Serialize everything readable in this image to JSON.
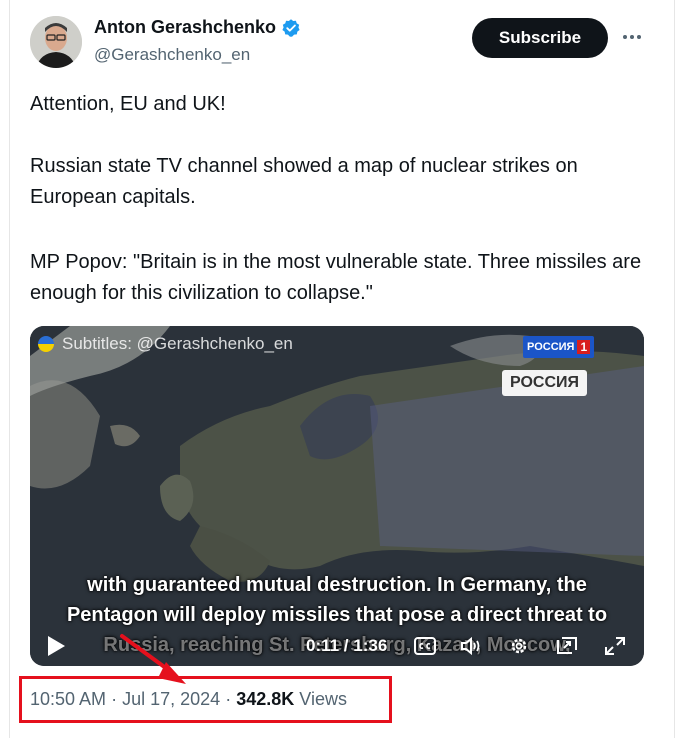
{
  "author": {
    "name": "Anton Gerashchenko",
    "handle": "@Gerashchenko_en",
    "verified": true,
    "verified_color": "#1d9bf0"
  },
  "actions": {
    "subscribe_label": "Subscribe",
    "more_icon": "more-horizontal-icon"
  },
  "tweet": {
    "paragraphs": [
      "Attention, EU and UK!",
      "Russian state TV channel showed a map of nuclear strikes on European capitals.",
      "MP Popov: \"Britain is in the most vulnerable state. Three missiles are enough for this civilization to collapse.\""
    ]
  },
  "video": {
    "subtitle_credit": "Subtitles: @Gerashchenko_en",
    "channel_logo": "РОССИЯ",
    "channel_number": "1",
    "map_label": "РОССИЯ",
    "captions": [
      "with guaranteed mutual destruction. In Germany, the",
      "Pentagon will deploy missiles that pose a direct threat to",
      "Russia, reaching St. Petersburg, Kazan, Moscow,"
    ],
    "time_display": "0:11 / 1:36",
    "progress_fraction": 0.115
  },
  "meta": {
    "time": "10:50 AM",
    "date": "Jul 17, 2024",
    "views_count": "342.8K",
    "views_label": "Views",
    "separator": "·"
  },
  "colors": {
    "highlight": "#e5101d",
    "text_primary": "#0f1419",
    "text_secondary": "#536471"
  }
}
